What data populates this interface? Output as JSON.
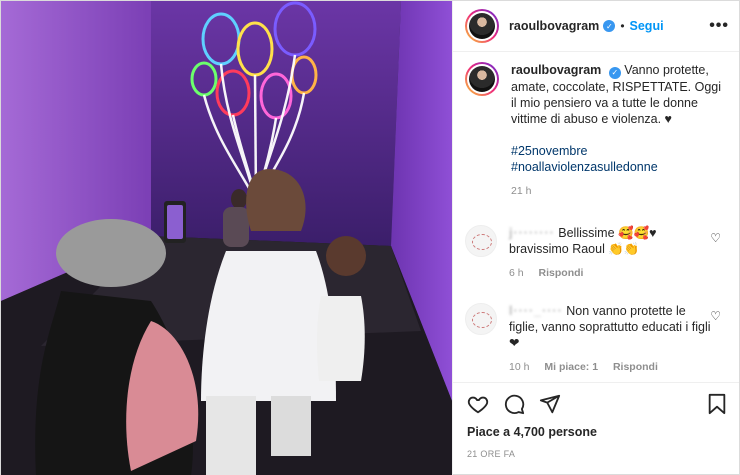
{
  "post": {
    "username": "raoulbovagram",
    "follow_label": "Segui",
    "more_label": "•••",
    "dot": "•"
  },
  "caption": {
    "username": "raoulbovagram",
    "text": "Vanno protette, amate, coccolate, RISPETTATE. Oggi il mio pensiero va a tutte le donne vittime di abuso e violenza. ♥",
    "tags": [
      "#25novembre",
      "#noallaviolenzasulledonne"
    ],
    "time": "21 h"
  },
  "comments": [
    {
      "username": "j········",
      "text": "Bellissime 🥰🥰♥ bravissimo Raoul 👏👏",
      "time": "6 h",
      "reply_label": "Rispondi",
      "likes_label": ""
    },
    {
      "username": "l····_····",
      "text": "Non vanno protette le figlie, vanno soprattutto educati i figli❤",
      "time": "10 h",
      "likes_label": "Mi piace: 1",
      "reply_label": "Rispondi"
    }
  ],
  "footer": {
    "likes": "Piace a 4,700 persone",
    "ago": "21 ORE FA"
  },
  "icons": [
    "heart-icon",
    "comment-icon",
    "share-icon",
    "bookmark-icon",
    "verified-icon",
    "more-icon"
  ],
  "colors": {
    "link": "#0095f6",
    "tag": "#00376b",
    "verified": "#3897f0",
    "muted": "#8e8e8e"
  }
}
